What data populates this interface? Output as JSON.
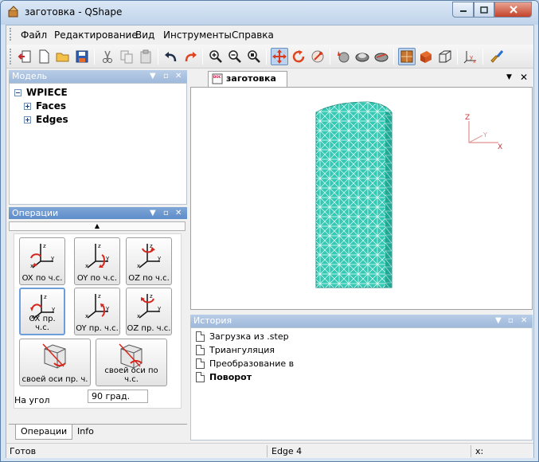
{
  "window": {
    "title": "заготовка - QShape"
  },
  "menu": [
    "Файл",
    "Редактирование",
    "Вид",
    "Инструменты",
    "Справка"
  ],
  "toolbar": {
    "icons": [
      "exit-icon",
      "new-document-icon",
      "open-folder-icon",
      "save-icon",
      "cut-icon",
      "copy-icon",
      "paste-icon",
      "undo-icon",
      "redo-icon",
      "zoom-in-icon",
      "zoom-out-icon",
      "zoom-fit-icon",
      "pan-icon",
      "rotate-icon",
      "orbit-icon",
      "shading-icon",
      "material-icon",
      "texture-icon",
      "shaded-view-icon",
      "surface-view-icon",
      "wireframe-view-icon",
      "axis-icon",
      "brush-icon"
    ]
  },
  "model_panel": {
    "title": "Модель",
    "root": "WPIECE",
    "children": [
      "Faces",
      "Edges"
    ]
  },
  "ops_panel": {
    "title": "Операции",
    "rows": [
      [
        "OX по ч.с.",
        "OY по ч.с.",
        "OZ по ч.с."
      ],
      [
        "OX пр. ч.с.",
        "OY пр. ч.с.",
        "OZ пр. ч.с."
      ]
    ],
    "big_buttons": [
      "своей оси пр. ч.",
      "своей оси по ч.с."
    ],
    "angle_label": "На угол",
    "angle_value": "90   град."
  },
  "left_tabs": [
    "Операции",
    "Info"
  ],
  "viewer": {
    "tab": "заготовка",
    "axes": {
      "z": "Z",
      "y": "Y",
      "x": "X"
    }
  },
  "history_panel": {
    "title": "История",
    "items": [
      "Загрузка из .step",
      "Триангуляция",
      "Преобразование в",
      "Поворот"
    ]
  },
  "status": {
    "left": "Готов",
    "middle": "Edge 4",
    "right": "x:"
  },
  "colors": {
    "mesh": "#35c8b3",
    "mesh_side": "#23a795",
    "accent": "#5b8bc9"
  }
}
